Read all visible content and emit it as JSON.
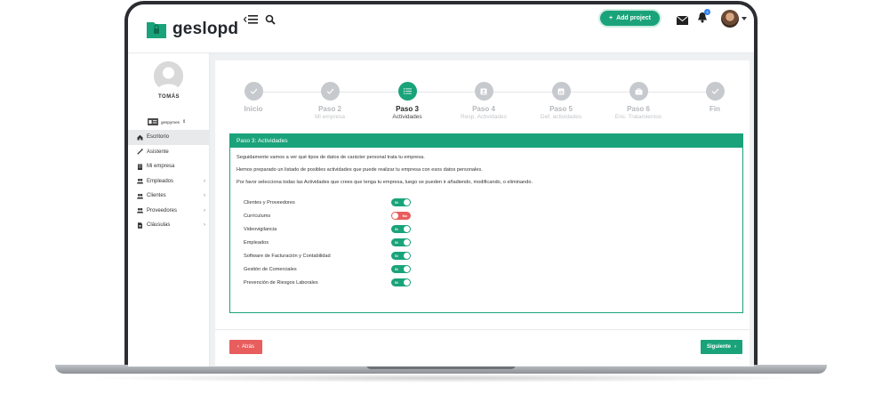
{
  "app": {
    "brand": "geslopd",
    "add_project_label": "Add project",
    "notification_count": "3"
  },
  "sidebar": {
    "user_name": "TOMÁS",
    "company": "gespymes",
    "items": [
      {
        "label": "Escritorio",
        "icon": "home-icon",
        "active": true
      },
      {
        "label": "Asistente",
        "icon": "wand-icon"
      },
      {
        "label": "Mi empresa",
        "icon": "building-icon"
      },
      {
        "label": "Empleados",
        "icon": "users-icon",
        "has_children": true
      },
      {
        "label": "Clientes",
        "icon": "users-icon",
        "has_children": true
      },
      {
        "label": "Proveedores",
        "icon": "users-icon",
        "has_children": true
      },
      {
        "label": "Cláusulas",
        "icon": "document-icon",
        "has_children": true
      }
    ]
  },
  "stepper": {
    "steps": [
      {
        "title": "Inicio",
        "sub": "",
        "state": "done"
      },
      {
        "title": "Paso 2",
        "sub": "Mi empresa",
        "state": "done"
      },
      {
        "title": "Paso 3",
        "sub": "Actividades",
        "state": "active"
      },
      {
        "title": "Paso 4",
        "sub": "Resp. Actividades",
        "state": "todo"
      },
      {
        "title": "Paso 5",
        "sub": "Def. actividades",
        "state": "todo"
      },
      {
        "title": "Paso 6",
        "sub": "Enc. Tratamientos",
        "state": "todo"
      },
      {
        "title": "Fin",
        "sub": "",
        "state": "todo"
      }
    ]
  },
  "panel": {
    "title": "Paso 3: Actividades",
    "intro_1": "Seguidamente vamos a ver qué tipos de datos de carácter personal trata tu empresa.",
    "intro_2": "Hemos preparado un listado de posibles actividades que puede realizar tu empresa con esos datos personales.",
    "intro_3": "Por favor selecciona todas las Actividades que crees que tenga tu empresa, luego se pueden ir añadiendo, modificando, o eliminando.",
    "activities": [
      {
        "label": "Clientes y Proveedores",
        "on": true,
        "toggle_text": "Sí"
      },
      {
        "label": "Currículums",
        "on": false,
        "toggle_text": "No"
      },
      {
        "label": "Videovigilancia",
        "on": true,
        "toggle_text": "Sí"
      },
      {
        "label": "Empleados",
        "on": true,
        "toggle_text": "Sí"
      },
      {
        "label": "Software de Facturación y Contabilidad",
        "on": true,
        "toggle_text": "Sí"
      },
      {
        "label": "Gestión de Comerciales",
        "on": true,
        "toggle_text": "Sí"
      },
      {
        "label": "Prevención de Riesgos Laborales",
        "on": true,
        "toggle_text": "Sí"
      }
    ]
  },
  "footer": {
    "back_label": "Atrás",
    "next_label": "Siguiente"
  },
  "colors": {
    "accent": "#1aa37a",
    "danger": "#e85d5d"
  }
}
